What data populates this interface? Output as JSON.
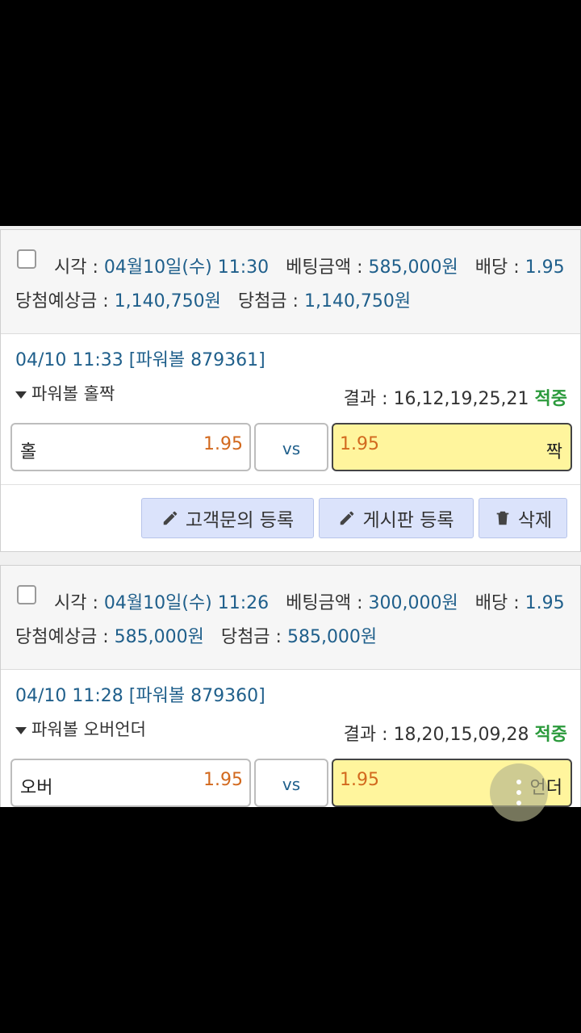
{
  "labels": {
    "time": "시각 : ",
    "bet_amount": "베팅금액 : ",
    "odds": "배당 : ",
    "expected_win": "당첨예상금 : ",
    "win": "당첨금 : ",
    "result": "결과 : ",
    "vs": "vs"
  },
  "bets": [
    {
      "time": "04월10일(수) 11:30",
      "bet_amount": "585,000원",
      "odds": "1.95",
      "expected_win": "1,140,750원",
      "win": "1,140,750원",
      "game_time": "04/10 11:33 [파워볼 879361]",
      "game_type": "파워볼 홀짝",
      "result": "16,12,19,25,21",
      "result_status": "적중",
      "home_name": "홀",
      "home_odds": "1.95",
      "away_odds": "1.95",
      "away_name": "짝"
    },
    {
      "time": "04월10일(수) 11:26",
      "bet_amount": "300,000원",
      "odds": "1.95",
      "expected_win": "585,000원",
      "win": "585,000원",
      "game_time": "04/10 11:28 [파워볼 879360]",
      "game_type": "파워볼 오버언더",
      "result": "18,20,15,09,28",
      "result_status": "적중",
      "home_name": "오버",
      "home_odds": "1.95",
      "away_odds": "1.95",
      "away_name": "언더"
    }
  ],
  "actions": {
    "inquiry": "고객문의 등록",
    "board": "게시판 등록",
    "delete": "삭제"
  },
  "icons": {
    "inquiry": "pencil-icon",
    "board": "pencil-icon",
    "delete": "trash-icon",
    "fab": "more-vertical-icon"
  },
  "colors": {
    "value": "#1f5f8b",
    "odds": "#d2691e",
    "hit": "#2b9a3c",
    "selected": "#fff59d",
    "button": "#dbe3fb"
  }
}
